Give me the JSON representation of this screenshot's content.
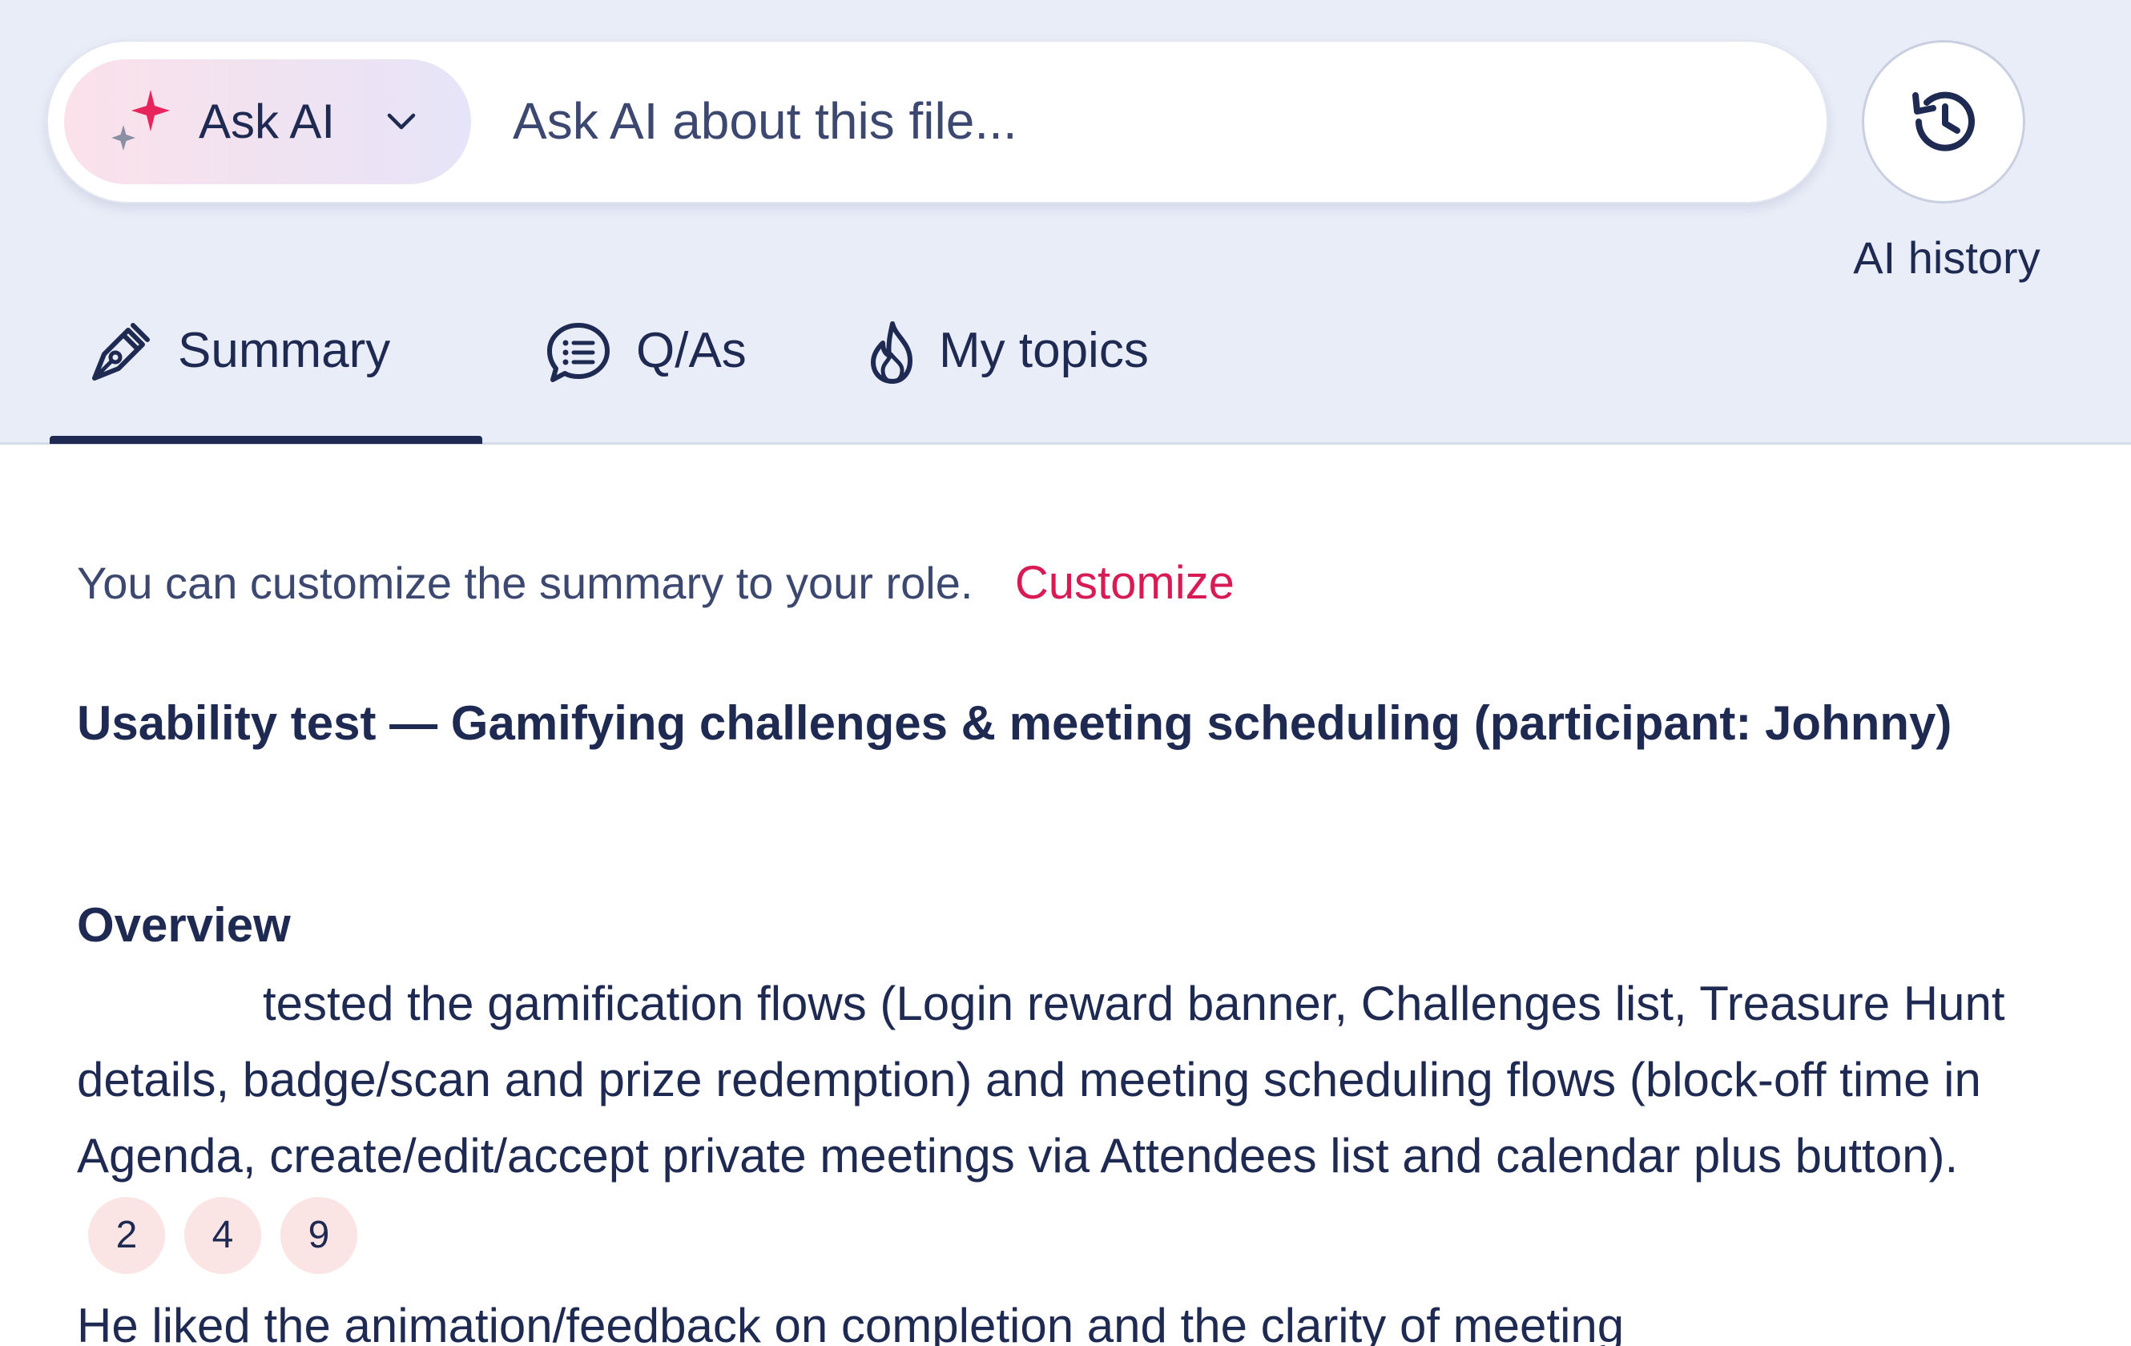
{
  "ask_bar": {
    "mode_label": "Ask AI",
    "mode_icon": "sparkle-icon",
    "input_placeholder": "Ask AI about this file...",
    "input_value": ""
  },
  "history": {
    "label": "AI history",
    "icon": "history-icon"
  },
  "tabs": [
    {
      "label": "Summary",
      "icon": "pen-icon",
      "active": true
    },
    {
      "label": "Q/As",
      "icon": "chat-list-icon",
      "active": false
    },
    {
      "label": "My topics",
      "icon": "flame-icon",
      "active": false
    }
  ],
  "customize": {
    "text": "You can customize the summary to your role.",
    "link_label": "Customize"
  },
  "summary": {
    "title": "Usability test — Gamifying challenges & meeting scheduling (participant: Johnny)",
    "overview_heading": "Overview",
    "overview_text": "tested the gamification flows (Login reward banner, Challenges list, Treasure Hunt details, badge/scan and prize redemption) and meeting scheduling flows (block-off time in Agenda, create/edit/accept private meetings via Attendees list and calendar plus button).",
    "citations": [
      "2",
      "4",
      "9"
    ],
    "next_paragraph": "He liked the animation/feedback on completion and the clarity of meeting"
  },
  "colors": {
    "header_bg": "#e9edf8",
    "text_primary": "#1e2a52",
    "accent_link": "#d81b55",
    "citation_bg": "#fbe4e4"
  }
}
